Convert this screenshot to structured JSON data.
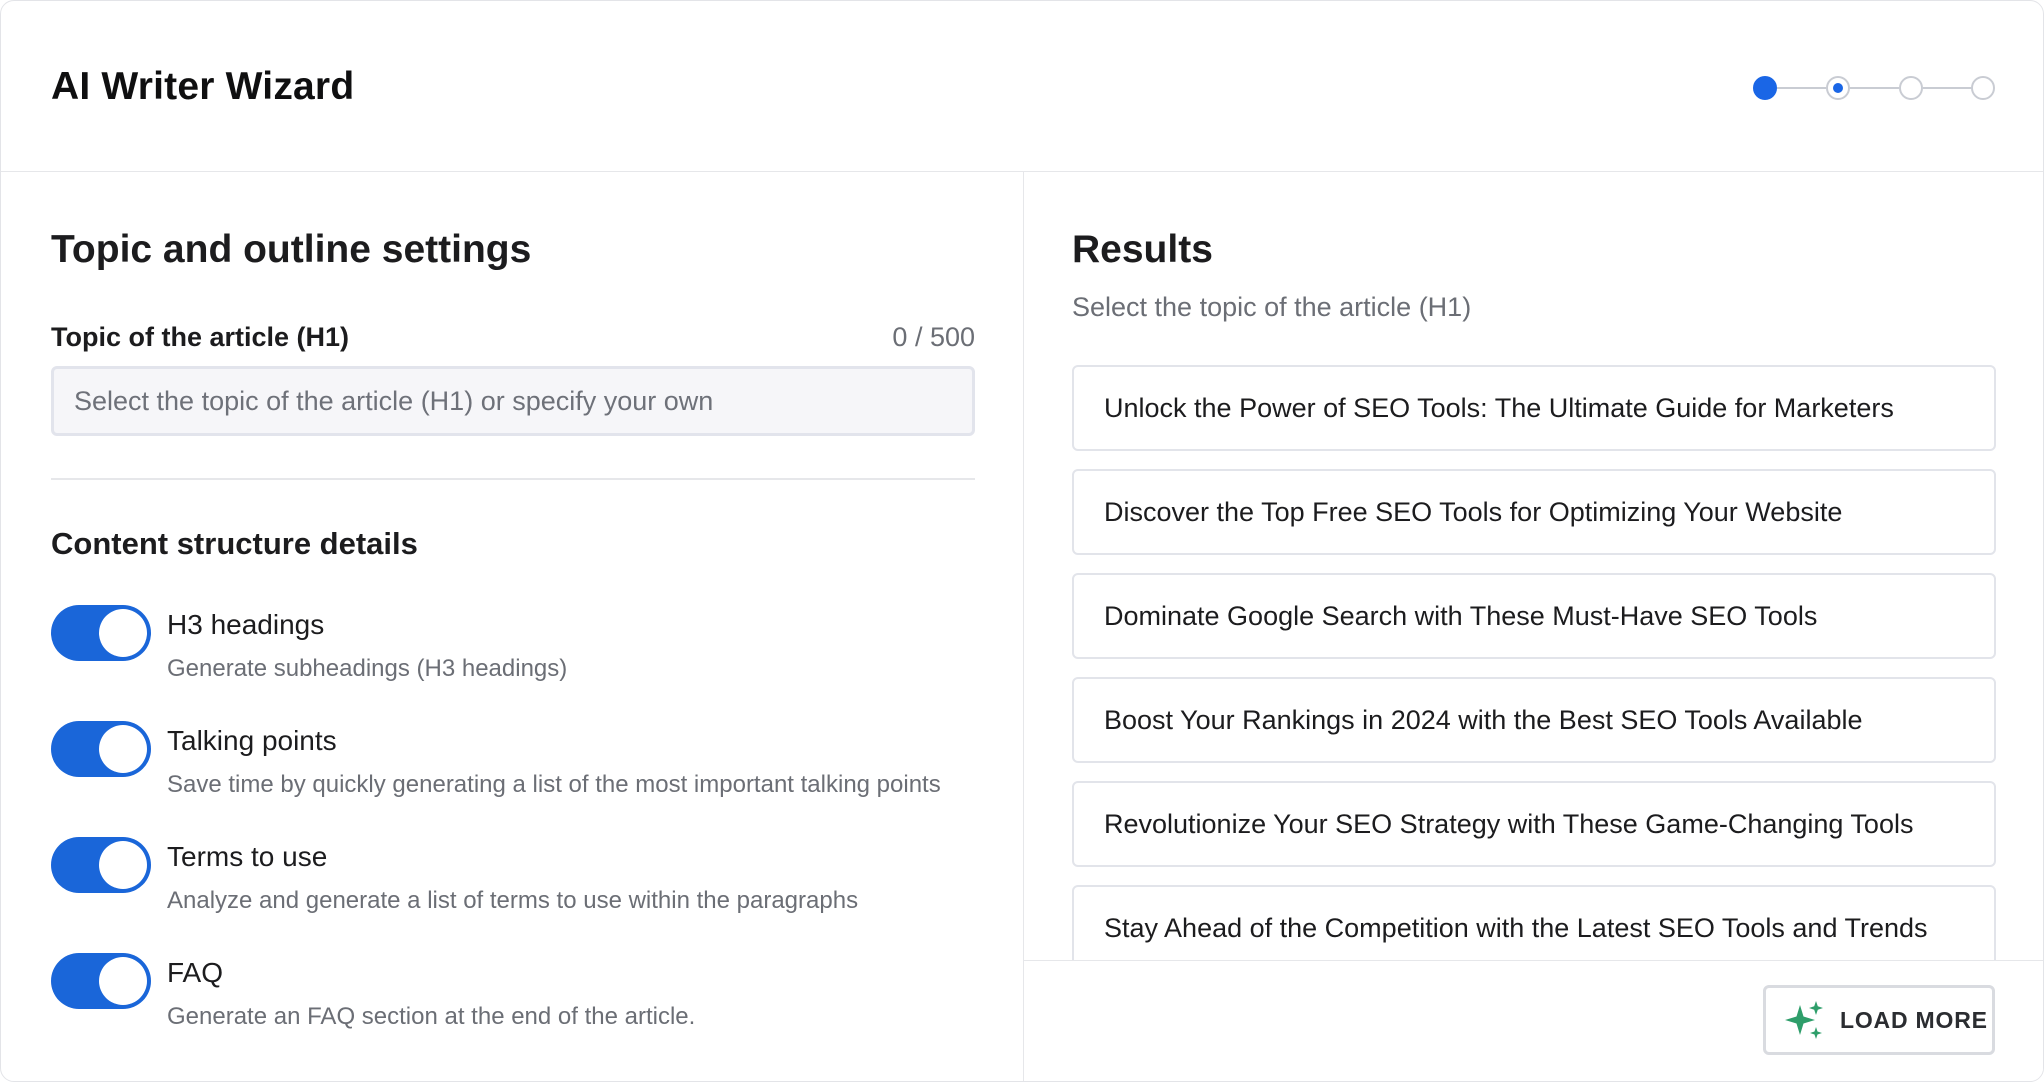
{
  "header": {
    "title": "AI Writer Wizard",
    "steps": [
      {
        "state": "done"
      },
      {
        "state": "current"
      },
      {
        "state": "upcoming"
      },
      {
        "state": "upcoming"
      }
    ]
  },
  "settings": {
    "title": "Topic and outline settings",
    "topic_label": "Topic of the article (H1)",
    "char_count": "0 / 500",
    "topic_value": "",
    "topic_placeholder": "Select the topic of the article (H1) or specify your own",
    "structure_title": "Content structure details",
    "options": [
      {
        "title": "H3 headings",
        "description": "Generate subheadings (H3 headings)",
        "enabled": true
      },
      {
        "title": "Talking points",
        "description": "Save time by quickly generating a list of the most important talking points",
        "enabled": true
      },
      {
        "title": "Terms to use",
        "description": "Analyze and generate a list of terms to use within the paragraphs",
        "enabled": true
      },
      {
        "title": "FAQ",
        "description": "Generate an FAQ section at the end of the article.",
        "enabled": true
      }
    ]
  },
  "results": {
    "title": "Results",
    "subtitle": "Select the topic of the article (H1)",
    "items": [
      "Unlock the Power of SEO Tools: The Ultimate Guide for Marketers",
      "Discover the Top Free SEO Tools for Optimizing Your Website",
      "Dominate Google Search with These Must-Have SEO Tools",
      "Boost Your Rankings in 2024 with the Best SEO Tools Available",
      "Revolutionize Your SEO Strategy with These Game-Changing Tools",
      "Stay Ahead of the Competition with the Latest SEO Tools and Trends"
    ],
    "load_more_label": "LOAD MORE",
    "load_more_icon": "sparkle-icon"
  },
  "colors": {
    "accent": "#1a66e6",
    "toggle_on": "#1a66d9",
    "sparkle": "#2e9e6a"
  }
}
